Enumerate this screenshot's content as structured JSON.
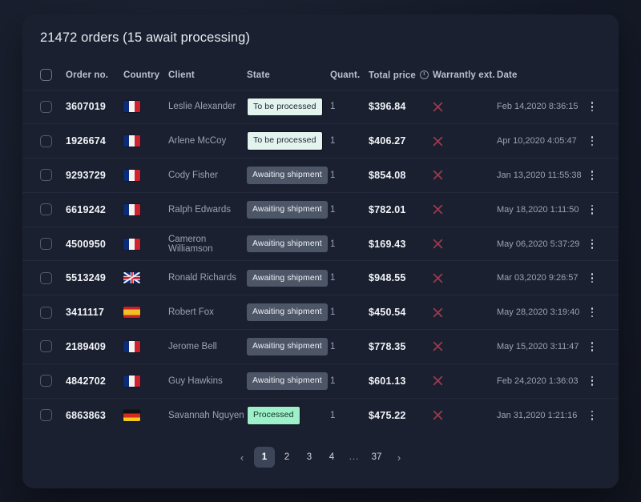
{
  "header": {
    "title": "21472 orders (15 await processing)"
  },
  "table": {
    "columns": [
      {
        "key": "select",
        "label": ""
      },
      {
        "key": "order_no",
        "label": "Order no."
      },
      {
        "key": "country",
        "label": "Country"
      },
      {
        "key": "client",
        "label": "Client"
      },
      {
        "key": "state",
        "label": "State"
      },
      {
        "key": "quant",
        "label": "Quant."
      },
      {
        "key": "price",
        "label": "Total price",
        "icon": "info-icon"
      },
      {
        "key": "warranty",
        "label": "Warrantly ext."
      },
      {
        "key": "date",
        "label": "Date"
      },
      {
        "key": "actions",
        "label": ""
      }
    ],
    "rows": [
      {
        "order_no": "3607019",
        "country": "FR",
        "client": "Leslie Alexander",
        "state": "To be processed",
        "state_kind": "tobe",
        "quant": "1",
        "price": "$396.84",
        "warranty": false,
        "date": "Feb 14,2020 8:36:15"
      },
      {
        "order_no": "1926674",
        "country": "FR",
        "client": "Arlene McCoy",
        "state": "To be processed",
        "state_kind": "tobe",
        "quant": "1",
        "price": "$406.27",
        "warranty": false,
        "date": "Apr 10,2020 4:05:47"
      },
      {
        "order_no": "9293729",
        "country": "FR",
        "client": "Cody Fisher",
        "state": "Awaiting shipment",
        "state_kind": "awaiting",
        "quant": "1",
        "price": "$854.08",
        "warranty": false,
        "date": "Jan 13,2020 11:55:38"
      },
      {
        "order_no": "6619242",
        "country": "FR",
        "client": "Ralph Edwards",
        "state": "Awaiting shipment",
        "state_kind": "awaiting",
        "quant": "1",
        "price": "$782.01",
        "warranty": false,
        "date": "May 18,2020 1:11:50"
      },
      {
        "order_no": "4500950",
        "country": "FR",
        "client": "Cameron Williamson",
        "state": "Awaiting shipment",
        "state_kind": "awaiting",
        "quant": "1",
        "price": "$169.43",
        "warranty": false,
        "date": "May 06,2020 5:37:29"
      },
      {
        "order_no": "5513249",
        "country": "GB",
        "client": "Ronald Richards",
        "state": "Awaiting shipment",
        "state_kind": "awaiting",
        "quant": "1",
        "price": "$948.55",
        "warranty": false,
        "date": "Mar 03,2020 9:26:57"
      },
      {
        "order_no": "3411117",
        "country": "ES",
        "client": "Robert Fox",
        "state": "Awaiting shipment",
        "state_kind": "awaiting",
        "quant": "1",
        "price": "$450.54",
        "warranty": false,
        "date": "May 28,2020 3:19:40"
      },
      {
        "order_no": "2189409",
        "country": "FR",
        "client": "Jerome Bell",
        "state": "Awaiting shipment",
        "state_kind": "awaiting",
        "quant": "1",
        "price": "$778.35",
        "warranty": false,
        "date": "May 15,2020 3:11:47"
      },
      {
        "order_no": "4842702",
        "country": "FR",
        "client": "Guy Hawkins",
        "state": "Awaiting shipment",
        "state_kind": "awaiting",
        "quant": "1",
        "price": "$601.13",
        "warranty": false,
        "date": "Feb 24,2020 1:36:03"
      },
      {
        "order_no": "6863863",
        "country": "DE",
        "client": "Savannah Nguyen",
        "state": "Processed",
        "state_kind": "processed",
        "quant": "1",
        "price": "$475.22",
        "warranty": false,
        "date": "Jan 31,2020 1:21:16"
      }
    ]
  },
  "pagination": {
    "prev_label": "‹",
    "next_label": "›",
    "items": [
      {
        "label": "1",
        "active": true
      },
      {
        "label": "2",
        "active": false
      },
      {
        "label": "3",
        "active": false
      },
      {
        "label": "4",
        "active": false
      },
      {
        "label": "...",
        "active": false,
        "dots": true
      },
      {
        "label": "37",
        "active": false
      }
    ]
  },
  "colors": {
    "page_background": "#171c2b",
    "card_background": "#1b2030",
    "row_divider": "#252b3c",
    "text_primary": "#f2f4f8",
    "text_secondary": "#9aa2b4",
    "badge_tobe_bg": "#e3f3ee",
    "badge_awaiting_bg": "#4d5667",
    "badge_processed_bg": "#9df0ca",
    "warranty_x": "#a03c4e",
    "pagination_active_bg": "#3d4658"
  }
}
